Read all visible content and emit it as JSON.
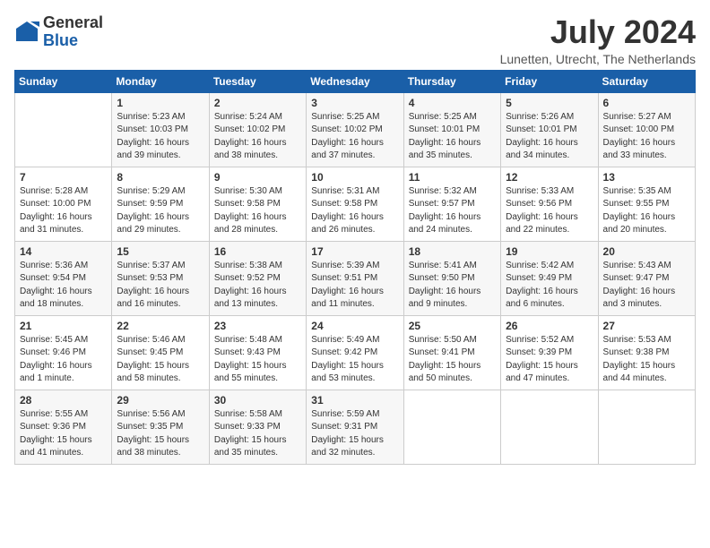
{
  "logo": {
    "general": "General",
    "blue": "Blue"
  },
  "title": "July 2024",
  "location": "Lunetten, Utrecht, The Netherlands",
  "days_of_week": [
    "Sunday",
    "Monday",
    "Tuesday",
    "Wednesday",
    "Thursday",
    "Friday",
    "Saturday"
  ],
  "weeks": [
    [
      {
        "day": "",
        "sunrise": "",
        "sunset": "",
        "daylight": "",
        "empty": true
      },
      {
        "day": "1",
        "sunrise": "Sunrise: 5:23 AM",
        "sunset": "Sunset: 10:03 PM",
        "daylight": "Daylight: 16 hours and 39 minutes."
      },
      {
        "day": "2",
        "sunrise": "Sunrise: 5:24 AM",
        "sunset": "Sunset: 10:02 PM",
        "daylight": "Daylight: 16 hours and 38 minutes."
      },
      {
        "day": "3",
        "sunrise": "Sunrise: 5:25 AM",
        "sunset": "Sunset: 10:02 PM",
        "daylight": "Daylight: 16 hours and 37 minutes."
      },
      {
        "day": "4",
        "sunrise": "Sunrise: 5:25 AM",
        "sunset": "Sunset: 10:01 PM",
        "daylight": "Daylight: 16 hours and 35 minutes."
      },
      {
        "day": "5",
        "sunrise": "Sunrise: 5:26 AM",
        "sunset": "Sunset: 10:01 PM",
        "daylight": "Daylight: 16 hours and 34 minutes."
      },
      {
        "day": "6",
        "sunrise": "Sunrise: 5:27 AM",
        "sunset": "Sunset: 10:00 PM",
        "daylight": "Daylight: 16 hours and 33 minutes."
      }
    ],
    [
      {
        "day": "7",
        "sunrise": "Sunrise: 5:28 AM",
        "sunset": "Sunset: 10:00 PM",
        "daylight": "Daylight: 16 hours and 31 minutes."
      },
      {
        "day": "8",
        "sunrise": "Sunrise: 5:29 AM",
        "sunset": "Sunset: 9:59 PM",
        "daylight": "Daylight: 16 hours and 29 minutes."
      },
      {
        "day": "9",
        "sunrise": "Sunrise: 5:30 AM",
        "sunset": "Sunset: 9:58 PM",
        "daylight": "Daylight: 16 hours and 28 minutes."
      },
      {
        "day": "10",
        "sunrise": "Sunrise: 5:31 AM",
        "sunset": "Sunset: 9:58 PM",
        "daylight": "Daylight: 16 hours and 26 minutes."
      },
      {
        "day": "11",
        "sunrise": "Sunrise: 5:32 AM",
        "sunset": "Sunset: 9:57 PM",
        "daylight": "Daylight: 16 hours and 24 minutes."
      },
      {
        "day": "12",
        "sunrise": "Sunrise: 5:33 AM",
        "sunset": "Sunset: 9:56 PM",
        "daylight": "Daylight: 16 hours and 22 minutes."
      },
      {
        "day": "13",
        "sunrise": "Sunrise: 5:35 AM",
        "sunset": "Sunset: 9:55 PM",
        "daylight": "Daylight: 16 hours and 20 minutes."
      }
    ],
    [
      {
        "day": "14",
        "sunrise": "Sunrise: 5:36 AM",
        "sunset": "Sunset: 9:54 PM",
        "daylight": "Daylight: 16 hours and 18 minutes."
      },
      {
        "day": "15",
        "sunrise": "Sunrise: 5:37 AM",
        "sunset": "Sunset: 9:53 PM",
        "daylight": "Daylight: 16 hours and 16 minutes."
      },
      {
        "day": "16",
        "sunrise": "Sunrise: 5:38 AM",
        "sunset": "Sunset: 9:52 PM",
        "daylight": "Daylight: 16 hours and 13 minutes."
      },
      {
        "day": "17",
        "sunrise": "Sunrise: 5:39 AM",
        "sunset": "Sunset: 9:51 PM",
        "daylight": "Daylight: 16 hours and 11 minutes."
      },
      {
        "day": "18",
        "sunrise": "Sunrise: 5:41 AM",
        "sunset": "Sunset: 9:50 PM",
        "daylight": "Daylight: 16 hours and 9 minutes."
      },
      {
        "day": "19",
        "sunrise": "Sunrise: 5:42 AM",
        "sunset": "Sunset: 9:49 PM",
        "daylight": "Daylight: 16 hours and 6 minutes."
      },
      {
        "day": "20",
        "sunrise": "Sunrise: 5:43 AM",
        "sunset": "Sunset: 9:47 PM",
        "daylight": "Daylight: 16 hours and 3 minutes."
      }
    ],
    [
      {
        "day": "21",
        "sunrise": "Sunrise: 5:45 AM",
        "sunset": "Sunset: 9:46 PM",
        "daylight": "Daylight: 16 hours and 1 minute."
      },
      {
        "day": "22",
        "sunrise": "Sunrise: 5:46 AM",
        "sunset": "Sunset: 9:45 PM",
        "daylight": "Daylight: 15 hours and 58 minutes."
      },
      {
        "day": "23",
        "sunrise": "Sunrise: 5:48 AM",
        "sunset": "Sunset: 9:43 PM",
        "daylight": "Daylight: 15 hours and 55 minutes."
      },
      {
        "day": "24",
        "sunrise": "Sunrise: 5:49 AM",
        "sunset": "Sunset: 9:42 PM",
        "daylight": "Daylight: 15 hours and 53 minutes."
      },
      {
        "day": "25",
        "sunrise": "Sunrise: 5:50 AM",
        "sunset": "Sunset: 9:41 PM",
        "daylight": "Daylight: 15 hours and 50 minutes."
      },
      {
        "day": "26",
        "sunrise": "Sunrise: 5:52 AM",
        "sunset": "Sunset: 9:39 PM",
        "daylight": "Daylight: 15 hours and 47 minutes."
      },
      {
        "day": "27",
        "sunrise": "Sunrise: 5:53 AM",
        "sunset": "Sunset: 9:38 PM",
        "daylight": "Daylight: 15 hours and 44 minutes."
      }
    ],
    [
      {
        "day": "28",
        "sunrise": "Sunrise: 5:55 AM",
        "sunset": "Sunset: 9:36 PM",
        "daylight": "Daylight: 15 hours and 41 minutes."
      },
      {
        "day": "29",
        "sunrise": "Sunrise: 5:56 AM",
        "sunset": "Sunset: 9:35 PM",
        "daylight": "Daylight: 15 hours and 38 minutes."
      },
      {
        "day": "30",
        "sunrise": "Sunrise: 5:58 AM",
        "sunset": "Sunset: 9:33 PM",
        "daylight": "Daylight: 15 hours and 35 minutes."
      },
      {
        "day": "31",
        "sunrise": "Sunrise: 5:59 AM",
        "sunset": "Sunset: 9:31 PM",
        "daylight": "Daylight: 15 hours and 32 minutes."
      },
      {
        "day": "",
        "sunrise": "",
        "sunset": "",
        "daylight": "",
        "empty": true
      },
      {
        "day": "",
        "sunrise": "",
        "sunset": "",
        "daylight": "",
        "empty": true
      },
      {
        "day": "",
        "sunrise": "",
        "sunset": "",
        "daylight": "",
        "empty": true
      }
    ]
  ]
}
